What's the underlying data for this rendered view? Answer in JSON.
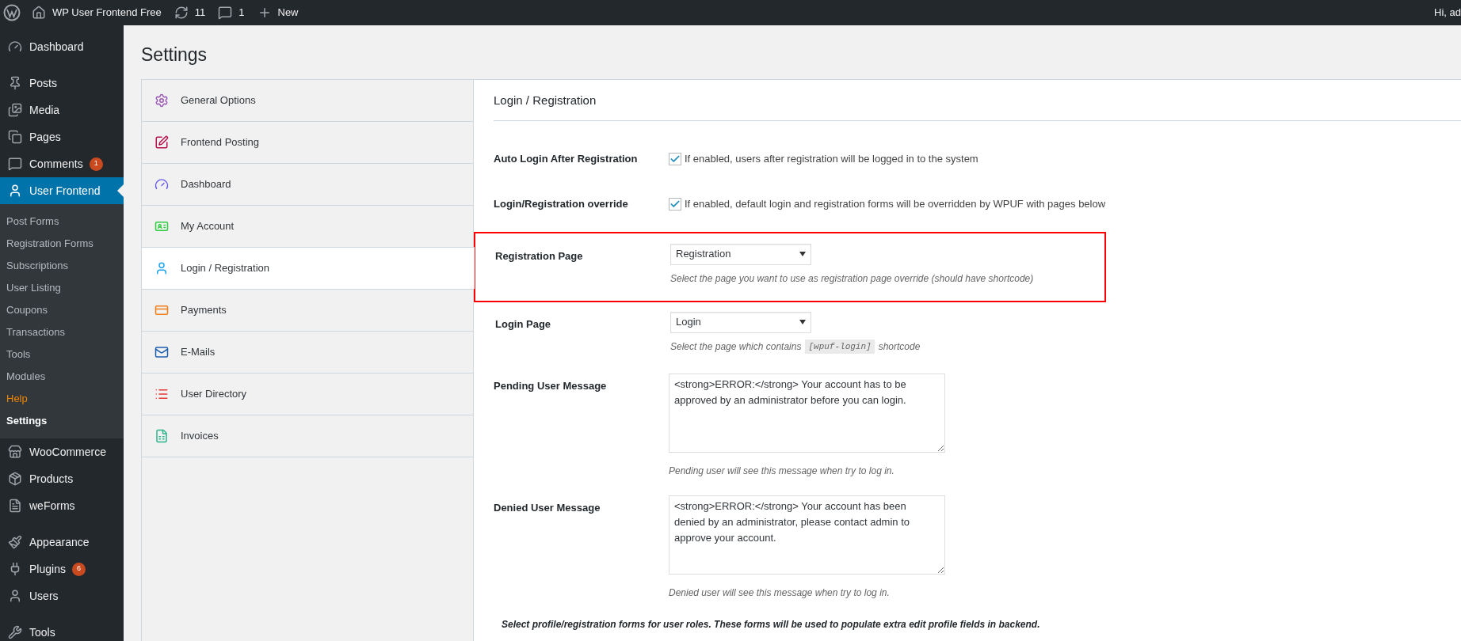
{
  "top_bar": {
    "items": [
      {
        "kind": "site",
        "label": "WP User Frontend Free"
      },
      {
        "kind": "updates",
        "label": "11"
      },
      {
        "kind": "comments",
        "label": "1"
      },
      {
        "kind": "new",
        "label": "New"
      }
    ],
    "greeting": "Hi, ad"
  },
  "sidebar": {
    "items": [
      {
        "kind": "dashboard",
        "label": "Dashboard",
        "selected": false
      },
      {
        "kind": "posts",
        "label": "Posts",
        "selected": false
      },
      {
        "kind": "media",
        "label": "Media",
        "selected": false
      },
      {
        "kind": "pages",
        "label": "Pages",
        "selected": false
      },
      {
        "kind": "comments",
        "label": "Comments",
        "badge": "1",
        "selected": false
      },
      {
        "kind": "user-frontend",
        "label": "User Frontend",
        "selected": true,
        "children": [
          {
            "label": "Post Forms",
            "selected": false,
            "highlighted": false
          },
          {
            "label": "Registration Forms",
            "selected": false,
            "highlighted": false
          },
          {
            "label": "Subscriptions",
            "selected": false,
            "highlighted": false
          },
          {
            "label": "User Listing",
            "selected": false,
            "highlighted": false
          },
          {
            "label": "Coupons",
            "selected": false,
            "highlighted": false
          },
          {
            "label": "Transactions",
            "selected": false,
            "highlighted": false
          },
          {
            "label": "Tools",
            "selected": false,
            "highlighted": false
          },
          {
            "label": "Modules",
            "selected": false,
            "highlighted": false
          },
          {
            "label": "Help",
            "selected": false,
            "highlighted": true
          },
          {
            "label": "Settings",
            "selected": true,
            "highlighted": false
          }
        ]
      },
      {
        "kind": "woo",
        "label": "WooCommerce",
        "selected": false
      },
      {
        "kind": "products",
        "label": "Products",
        "selected": false
      },
      {
        "kind": "weforms",
        "label": "weForms",
        "selected": false
      },
      {
        "kind": "appearance",
        "label": "Appearance",
        "selected": false
      },
      {
        "kind": "plugins",
        "label": "Plugins",
        "badge": "6",
        "selected": false
      },
      {
        "kind": "users",
        "label": "Users",
        "selected": false
      },
      {
        "kind": "tools",
        "label": "Tools",
        "selected": false
      }
    ]
  },
  "page_title": "Settings",
  "settings_tabs": [
    {
      "kind": "gear",
      "label": "General Options",
      "selected": false
    },
    {
      "kind": "posting",
      "label": "Frontend Posting",
      "selected": false
    },
    {
      "kind": "dashboard",
      "label": "Dashboard",
      "selected": false
    },
    {
      "kind": "account",
      "label": "My Account",
      "selected": false
    },
    {
      "kind": "user",
      "label": "Login / Registration",
      "selected": true
    },
    {
      "kind": "payments",
      "label": "Payments",
      "selected": false
    },
    {
      "kind": "mail",
      "label": "E-Mails",
      "selected": false
    },
    {
      "kind": "directory",
      "label": "User Directory",
      "selected": false
    },
    {
      "kind": "invoice",
      "label": "Invoices",
      "selected": false
    }
  ],
  "section": {
    "title": "Login / Registration",
    "fields": [
      {
        "kind": "checkbox",
        "label": "Auto Login After Registration",
        "checked": true,
        "text": "If enabled, users after registration will be logged in to the system"
      },
      {
        "kind": "checkbox",
        "label": "Login/Registration override",
        "checked": true,
        "text": "If enabled, default login and registration forms will be overridden by WPUF with pages below"
      },
      {
        "kind": "select",
        "label": "Registration Page",
        "value": "Registration",
        "hint": "Select the page you want to use as registration page override (should have shortcode)",
        "highlighted": true
      },
      {
        "kind": "select",
        "label": "Login Page",
        "value": "Login",
        "hint": "Select the page which contains",
        "code": "[wpuf-login]",
        "hint_after": "shortcode",
        "highlighted": false
      },
      {
        "kind": "textarea",
        "label": "Pending User Message",
        "value": "<strong>ERROR:</strong> Your account has to be approved by an administrator before you can login.",
        "hint": "Pending user will see this message when try to log in."
      },
      {
        "kind": "textarea",
        "label": "Denied User Message",
        "value": "<strong>ERROR:</strong> Your account has been denied by an administrator, please contact admin to approve your account.",
        "hint": "Denied user will see this message when try to log in."
      }
    ],
    "note": "Select profile/registration forms for user roles. These forms will be used to populate extra edit profile fields in backend."
  }
}
